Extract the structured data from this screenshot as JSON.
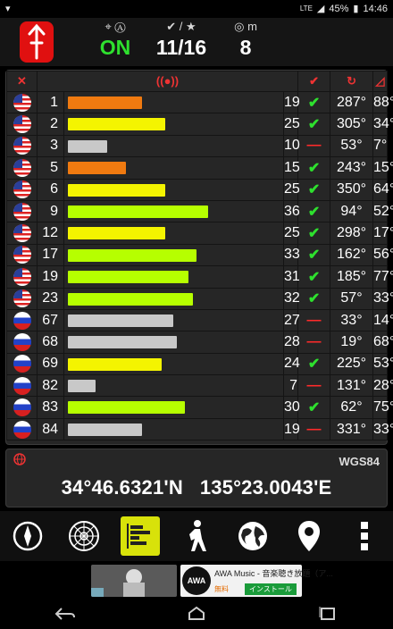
{
  "status_bar": {
    "time": "14:46",
    "battery": "45%",
    "network": "LTE"
  },
  "header": {
    "fix_status": "ON",
    "satellites_used_total": "11/16",
    "accuracy_m": "8",
    "accuracy_unit": "m"
  },
  "colors": {
    "on": "#2ee02e",
    "check": "#2ee02e",
    "dash": "#ff2a2a",
    "bar_orange": "#f07a10",
    "bar_yellow": "#f4f400",
    "bar_lime": "#b6ff00",
    "bar_gray": "#c8c8c8",
    "nav_active": "#d8e20a"
  },
  "satellites": [
    {
      "flag": "us",
      "id": "1",
      "snr": "19",
      "used": true,
      "azimuth": "287°",
      "elevation": "88°",
      "bar_color": "#f07a10"
    },
    {
      "flag": "us",
      "id": "2",
      "snr": "25",
      "used": true,
      "azimuth": "305°",
      "elevation": "34°",
      "bar_color": "#f4f400"
    },
    {
      "flag": "us",
      "id": "3",
      "snr": "10",
      "used": false,
      "azimuth": "53°",
      "elevation": "7°",
      "bar_color": "#c8c8c8"
    },
    {
      "flag": "us",
      "id": "5",
      "snr": "15",
      "used": true,
      "azimuth": "243°",
      "elevation": "15°",
      "bar_color": "#f07a10"
    },
    {
      "flag": "us",
      "id": "6",
      "snr": "25",
      "used": true,
      "azimuth": "350°",
      "elevation": "64°",
      "bar_color": "#f4f400"
    },
    {
      "flag": "us",
      "id": "9",
      "snr": "36",
      "used": true,
      "azimuth": "94°",
      "elevation": "52°",
      "bar_color": "#b6ff00"
    },
    {
      "flag": "us",
      "id": "12",
      "snr": "25",
      "used": true,
      "azimuth": "298°",
      "elevation": "17°",
      "bar_color": "#f4f400"
    },
    {
      "flag": "us",
      "id": "17",
      "snr": "33",
      "used": true,
      "azimuth": "162°",
      "elevation": "56°",
      "bar_color": "#b6ff00"
    },
    {
      "flag": "us",
      "id": "19",
      "snr": "31",
      "used": true,
      "azimuth": "185°",
      "elevation": "77°",
      "bar_color": "#b6ff00"
    },
    {
      "flag": "us",
      "id": "23",
      "snr": "32",
      "used": true,
      "azimuth": "57°",
      "elevation": "33°",
      "bar_color": "#b6ff00"
    },
    {
      "flag": "ru",
      "id": "67",
      "snr": "27",
      "used": false,
      "azimuth": "33°",
      "elevation": "14°",
      "bar_color": "#c8c8c8"
    },
    {
      "flag": "ru",
      "id": "68",
      "snr": "28",
      "used": false,
      "azimuth": "19°",
      "elevation": "68°",
      "bar_color": "#c8c8c8"
    },
    {
      "flag": "ru",
      "id": "69",
      "snr": "24",
      "used": true,
      "azimuth": "225°",
      "elevation": "53°",
      "bar_color": "#f4f400"
    },
    {
      "flag": "ru",
      "id": "82",
      "snr": "7",
      "used": false,
      "azimuth": "131°",
      "elevation": "28°",
      "bar_color": "#c8c8c8"
    },
    {
      "flag": "ru",
      "id": "83",
      "snr": "30",
      "used": true,
      "azimuth": "62°",
      "elevation": "75°",
      "bar_color": "#b6ff00"
    },
    {
      "flag": "ru",
      "id": "84",
      "snr": "19",
      "used": false,
      "azimuth": "331°",
      "elevation": "33°",
      "bar_color": "#c8c8c8"
    }
  ],
  "position": {
    "datum": "WGS84",
    "coordinates": "34°46.6321'N   135°23.0043'E"
  },
  "nav": [
    {
      "name": "compass-icon"
    },
    {
      "name": "radar-icon"
    },
    {
      "name": "signal-bars-icon",
      "active": true
    },
    {
      "name": "walker-icon"
    },
    {
      "name": "globe-icon"
    },
    {
      "name": "location-pin-icon"
    },
    {
      "name": "more-icon"
    }
  ],
  "ad": {
    "title": "AWA Music - 音楽聴き放題（ア...",
    "free_label": "無料",
    "install_label": "インストール",
    "logo_text": "AWA"
  }
}
